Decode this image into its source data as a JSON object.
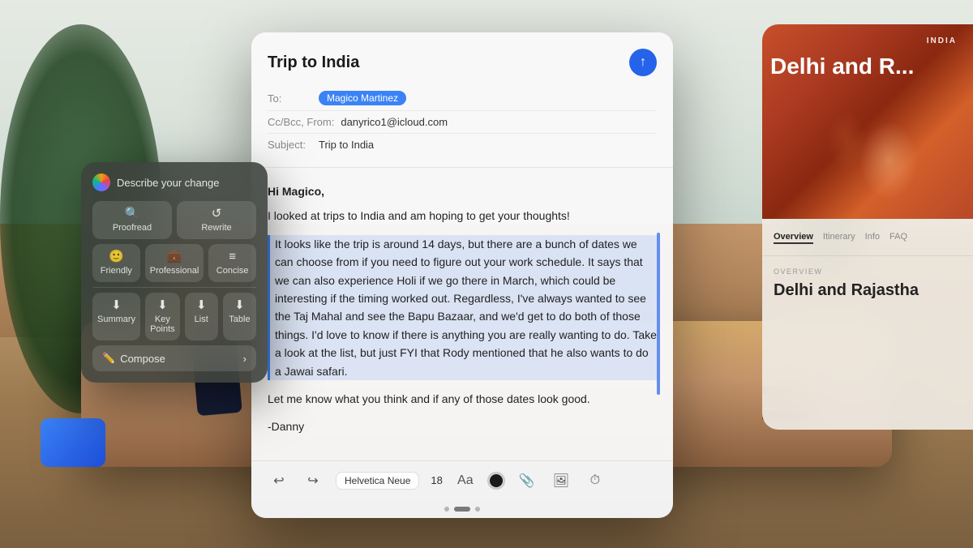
{
  "background": {
    "alt": "Living room with plants and wooden table"
  },
  "writingTools": {
    "title": "Describe your change",
    "icon_label": "sparkle-icon",
    "buttons": {
      "row1": [
        {
          "id": "proofread",
          "icon": "🔍",
          "label": "Proofread"
        },
        {
          "id": "rewrite",
          "icon": "↺",
          "label": "Rewrite"
        }
      ],
      "row2": [
        {
          "id": "friendly",
          "icon": "🙂",
          "label": "Friendly"
        },
        {
          "id": "professional",
          "icon": "💼",
          "label": "Professional"
        },
        {
          "id": "concise",
          "icon": "≡",
          "label": "Concise"
        }
      ],
      "row3": [
        {
          "id": "summary",
          "icon": "⬇",
          "label": "Summary"
        },
        {
          "id": "keypoints",
          "icon": "⬇",
          "label": "Key Points"
        },
        {
          "id": "list",
          "icon": "⬇",
          "label": "List"
        },
        {
          "id": "table",
          "icon": "⬇",
          "label": "Table"
        }
      ]
    },
    "composeLabel": "Compose",
    "chevron": "›"
  },
  "email": {
    "title": "Trip to India",
    "toLabel": "To:",
    "recipient": "Magico Martinez",
    "ccbccFrom": "Cc/Bcc, From: danyrico1@icloud.com",
    "ccbccLabel": "Cc/Bcc, From:",
    "fromEmail": "danyrico1@icloud.com",
    "subjectLabel": "Subject:",
    "subject": "Trip to India",
    "sendIcon": "↑",
    "body": {
      "greeting": "Hi Magico,",
      "intro": "I looked at trips to India and am hoping to get your thoughts!",
      "highlighted": "It looks like the trip is around 14 days, but there are a bunch of dates we can choose from if you need to figure out your work schedule. It says that we can also experience Holi if we go there in March, which could be interesting if the timing worked out. Regardless, I've always wanted to see the Taj Mahal and see the Bapu Bazaar, and we'd get to do both of those things.  I'd love to know if there is anything you are really wanting to do. Take a look at the list, but just FYI that Rody mentioned that he also wants to do a Jawai safari.",
      "closing": "Let me know what you think and if any of those dates look good.",
      "signature": "-Danny"
    },
    "toolbar": {
      "undo": "↩",
      "redo": "↪",
      "font": "Helvetica Neue",
      "fontSize": "18",
      "formatIcon": "Aa",
      "colorDot": "#1a1a1a",
      "attachIcon": "📎",
      "photoIcon": "🖼",
      "timerIcon": "⏱"
    }
  },
  "indiaPanel": {
    "topLabel": "INDIA",
    "title": "Delhi and R...",
    "fullTitle": "Delhi and Rajastha...",
    "nav": [
      {
        "label": "Overview",
        "active": true
      },
      {
        "label": "Itinerary",
        "active": false
      },
      {
        "label": "Info",
        "active": false
      },
      {
        "label": "FAQ",
        "active": false
      }
    ],
    "overviewLabel": "OVERVIEW",
    "overviewTitle": "Delhi and Rajastha"
  },
  "colors": {
    "sendBlue": "#2563eb",
    "chipBlue": "#3b82f6",
    "highlightBlue": "rgba(59,130,246,0.15)",
    "toolsBg": "rgba(60,65,60,0.88)"
  }
}
